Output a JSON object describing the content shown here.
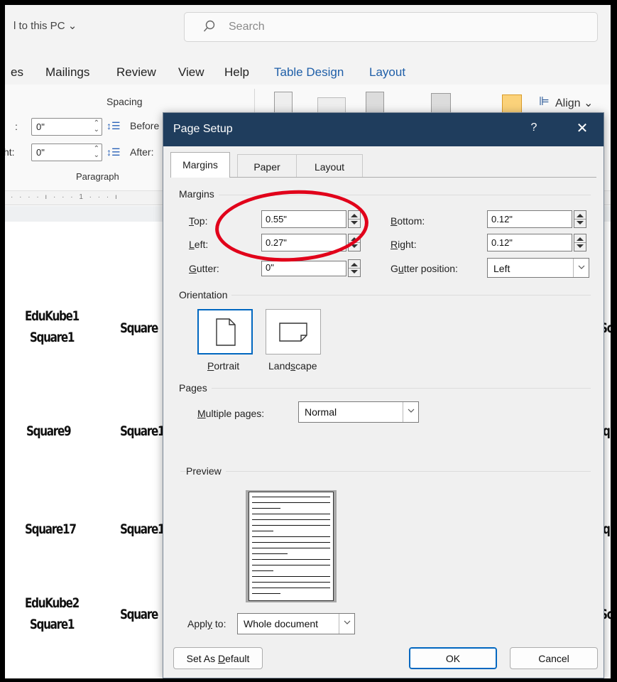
{
  "titlebar": {
    "saved_status": "l to this PC ⌄",
    "search_placeholder": "Search"
  },
  "menu": {
    "items": [
      "es",
      "Mailings",
      "Review",
      "View",
      "Help",
      "Table Design",
      "Layout"
    ]
  },
  "ribbon": {
    "spacing_label": "Spacing",
    "indent_left_label": ":",
    "indent_left_value": "0\"",
    "indent_right_label": "ht:",
    "indent_right_value": "0\"",
    "before_label": "Before",
    "after_label": "After:",
    "paragraph_group": "Paragraph",
    "align_label": "Align ⌄"
  },
  "ruler": {
    "text": "· · · · ı · · · 1 · · · ı"
  },
  "document": {
    "words": [
      "EduKube1",
      "Square1",
      "Square",
      "Square9",
      "Square1",
      "Square17",
      "Square1",
      "EduKube2",
      "Square1",
      "Square"
    ],
    "right_fragments": [
      "Sc",
      "q",
      "q",
      "Sc"
    ]
  },
  "dialog": {
    "title": "Page Setup",
    "help": "?",
    "close": "✕",
    "tabs": [
      "Margins",
      "Paper",
      "Layout"
    ],
    "margins_group": "Margins",
    "top_label": "Top:",
    "top_value": "0.55\"",
    "bottom_label": "Bottom:",
    "bottom_value": "0.12\"",
    "left_label": "Left:",
    "left_value": "0.27\"",
    "right_label": "Right:",
    "right_value": "0.12\"",
    "gutter_label": "Gutter:",
    "gutter_value": "0\"",
    "gutter_position_label": "Gutter position:",
    "gutter_position_value": "Left",
    "orientation_group": "Orientation",
    "portrait_label": "Portrait",
    "landscape_label": "Landscape",
    "pages_group": "Pages",
    "multiple_pages_label": "Multiple pages:",
    "multiple_pages_value": "Normal",
    "preview_group": "Preview",
    "apply_to_label": "Apply to:",
    "apply_to_value": "Whole document",
    "set_default_label": "Set As Default",
    "ok_label": "OK",
    "cancel_label": "Cancel"
  },
  "colors": {
    "dialog_title_bg": "#1f3d5d",
    "accent": "#0067c0",
    "annotation_circle": "#e1001a",
    "context_tab": "#1f5fa8"
  }
}
